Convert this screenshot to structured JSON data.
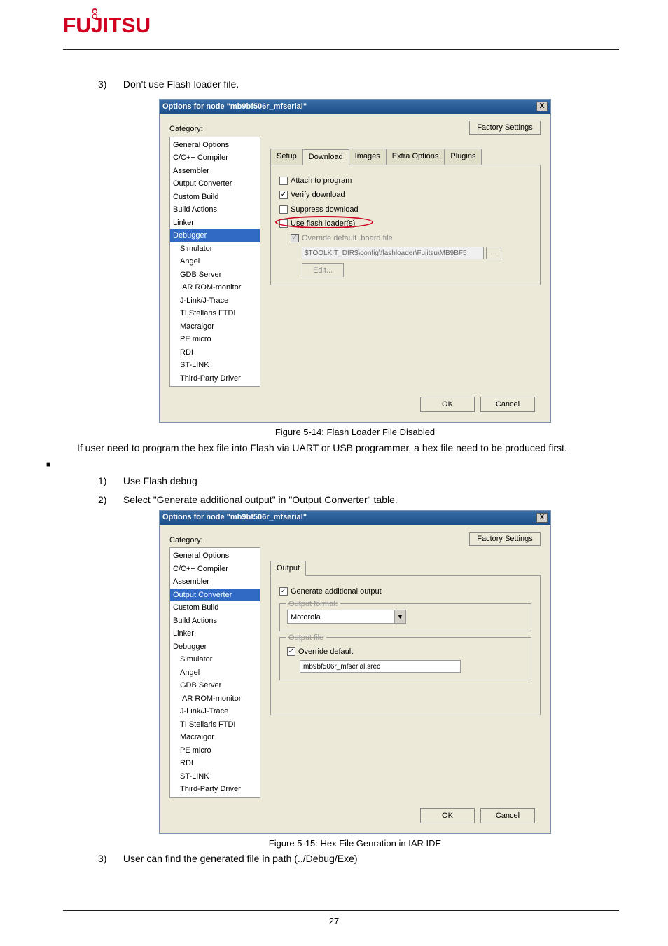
{
  "page": {
    "logo": "FUJITSU",
    "number": "27"
  },
  "step3a": {
    "num": "3)",
    "text": "Don't use Flash loader file."
  },
  "dialog1": {
    "title": "Options for node \"mb9bf506r_mfserial\"",
    "close": "X",
    "categoryLabel": "Category:",
    "factory": "Factory Settings",
    "categories": [
      {
        "label": "General Options",
        "sub": false
      },
      {
        "label": "C/C++ Compiler",
        "sub": false
      },
      {
        "label": "Assembler",
        "sub": false
      },
      {
        "label": "Output Converter",
        "sub": false
      },
      {
        "label": "Custom Build",
        "sub": false
      },
      {
        "label": "Build Actions",
        "sub": false
      },
      {
        "label": "Linker",
        "sub": false
      },
      {
        "label": "Debugger",
        "sub": false,
        "sel": true
      },
      {
        "label": "Simulator",
        "sub": true
      },
      {
        "label": "Angel",
        "sub": true
      },
      {
        "label": "GDB Server",
        "sub": true
      },
      {
        "label": "IAR ROM-monitor",
        "sub": true
      },
      {
        "label": "J-Link/J-Trace",
        "sub": true
      },
      {
        "label": "TI Stellaris FTDI",
        "sub": true
      },
      {
        "label": "Macraigor",
        "sub": true
      },
      {
        "label": "PE micro",
        "sub": true
      },
      {
        "label": "RDI",
        "sub": true
      },
      {
        "label": "ST-LINK",
        "sub": true
      },
      {
        "label": "Third-Party Driver",
        "sub": true
      }
    ],
    "tabs": {
      "setup": "Setup",
      "download": "Download",
      "images": "Images",
      "extra": "Extra Options",
      "plugins": "Plugins"
    },
    "attach": "Attach to program",
    "verify": "Verify download",
    "suppress": "Suppress download",
    "useflash": "Use flash loader(s)",
    "override": "Override default .board file",
    "path": "$TOOLKIT_DIR$\\config\\flashloader\\Fujitsu\\MB9BF5",
    "dots": "...",
    "edit": "Edit...",
    "ok": "OK",
    "cancel": "Cancel"
  },
  "caption1": "Figure 5-14: Flash Loader File Disabled",
  "para1": "If user need to program the hex file into Flash via UART or USB programmer, a hex file need to be produced first.",
  "bullet": "■",
  "step1b": {
    "num": "1)",
    "text": "Use Flash debug"
  },
  "step2b": {
    "num": "2)",
    "text": "Select \"Generate additional output\" in \"Output Converter\" table."
  },
  "dialog2": {
    "title": "Options for node \"mb9bf506r_mfserial\"",
    "close": "X",
    "categoryLabel": "Category:",
    "factory": "Factory Settings",
    "categories": [
      {
        "label": "General Options",
        "sub": false
      },
      {
        "label": "C/C++ Compiler",
        "sub": false
      },
      {
        "label": "Assembler",
        "sub": false
      },
      {
        "label": "Output Converter",
        "sub": false,
        "sel": true
      },
      {
        "label": "Custom Build",
        "sub": false
      },
      {
        "label": "Build Actions",
        "sub": false
      },
      {
        "label": "Linker",
        "sub": false
      },
      {
        "label": "Debugger",
        "sub": false
      },
      {
        "label": "Simulator",
        "sub": true
      },
      {
        "label": "Angel",
        "sub": true
      },
      {
        "label": "GDB Server",
        "sub": true
      },
      {
        "label": "IAR ROM-monitor",
        "sub": true
      },
      {
        "label": "J-Link/J-Trace",
        "sub": true
      },
      {
        "label": "TI Stellaris FTDI",
        "sub": true
      },
      {
        "label": "Macraigor",
        "sub": true
      },
      {
        "label": "PE micro",
        "sub": true
      },
      {
        "label": "RDI",
        "sub": true
      },
      {
        "label": "ST-LINK",
        "sub": true
      },
      {
        "label": "Third-Party Driver",
        "sub": true
      }
    ],
    "tabs": {
      "output": "Output"
    },
    "generate": "Generate additional output",
    "fmtLegend": "Output format:",
    "fmtValue": "Motorola",
    "fileLegend": "Output file",
    "override": "Override default",
    "outfile": "mb9bf506r_mfserial.srec",
    "ok": "OK",
    "cancel": "Cancel"
  },
  "caption2": "Figure 5-15: Hex File Genration in IAR IDE",
  "step3b": {
    "num": "3)",
    "text": "User can find the generated file in path (../Debug/Exe)"
  }
}
